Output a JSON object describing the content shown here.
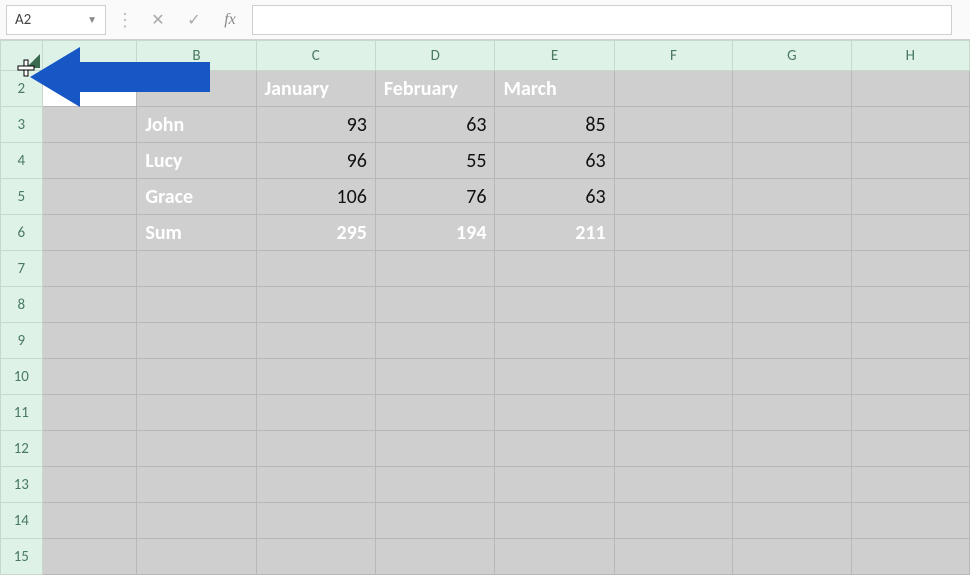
{
  "formula_bar": {
    "name_box": "A2",
    "formula": ""
  },
  "columns": [
    "B",
    "C",
    "D",
    "E",
    "F",
    "G",
    "H"
  ],
  "rows": [
    "2",
    "3",
    "4",
    "5",
    "6",
    "7",
    "8",
    "9",
    "10",
    "11",
    "12",
    "13",
    "14",
    "15"
  ],
  "chart_data": {
    "type": "table",
    "title": "",
    "months": [
      "January",
      "February",
      "March"
    ],
    "series": [
      {
        "name": "John",
        "values": [
          93,
          63,
          85
        ]
      },
      {
        "name": "Lucy",
        "values": [
          96,
          55,
          63
        ]
      },
      {
        "name": "Grace",
        "values": [
          106,
          76,
          63
        ]
      }
    ],
    "sum_label": "Sum",
    "sum_values": [
      295,
      194,
      211
    ]
  }
}
